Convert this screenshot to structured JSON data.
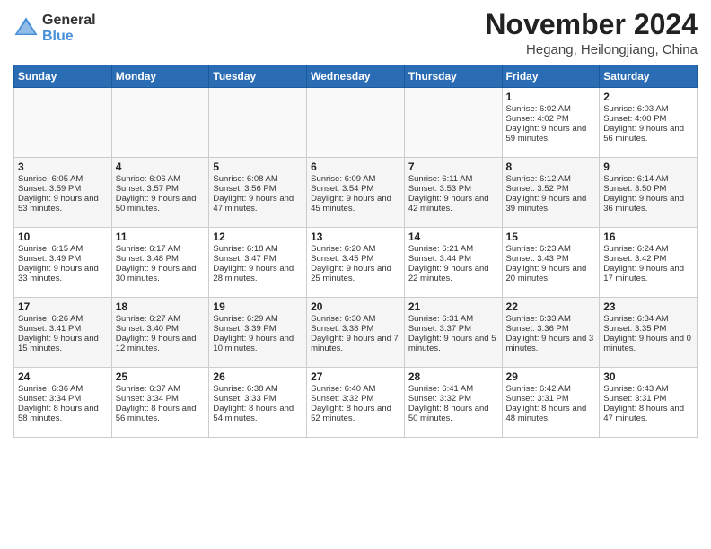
{
  "header": {
    "logo_general": "General",
    "logo_blue": "Blue",
    "month_title": "November 2024",
    "location": "Hegang, Heilongjiang, China"
  },
  "weekdays": [
    "Sunday",
    "Monday",
    "Tuesday",
    "Wednesday",
    "Thursday",
    "Friday",
    "Saturday"
  ],
  "weeks": [
    [
      {
        "day": "",
        "info": ""
      },
      {
        "day": "",
        "info": ""
      },
      {
        "day": "",
        "info": ""
      },
      {
        "day": "",
        "info": ""
      },
      {
        "day": "",
        "info": ""
      },
      {
        "day": "1",
        "info": "Sunrise: 6:02 AM\nSunset: 4:02 PM\nDaylight: 9 hours and 59 minutes."
      },
      {
        "day": "2",
        "info": "Sunrise: 6:03 AM\nSunset: 4:00 PM\nDaylight: 9 hours and 56 minutes."
      }
    ],
    [
      {
        "day": "3",
        "info": "Sunrise: 6:05 AM\nSunset: 3:59 PM\nDaylight: 9 hours and 53 minutes."
      },
      {
        "day": "4",
        "info": "Sunrise: 6:06 AM\nSunset: 3:57 PM\nDaylight: 9 hours and 50 minutes."
      },
      {
        "day": "5",
        "info": "Sunrise: 6:08 AM\nSunset: 3:56 PM\nDaylight: 9 hours and 47 minutes."
      },
      {
        "day": "6",
        "info": "Sunrise: 6:09 AM\nSunset: 3:54 PM\nDaylight: 9 hours and 45 minutes."
      },
      {
        "day": "7",
        "info": "Sunrise: 6:11 AM\nSunset: 3:53 PM\nDaylight: 9 hours and 42 minutes."
      },
      {
        "day": "8",
        "info": "Sunrise: 6:12 AM\nSunset: 3:52 PM\nDaylight: 9 hours and 39 minutes."
      },
      {
        "day": "9",
        "info": "Sunrise: 6:14 AM\nSunset: 3:50 PM\nDaylight: 9 hours and 36 minutes."
      }
    ],
    [
      {
        "day": "10",
        "info": "Sunrise: 6:15 AM\nSunset: 3:49 PM\nDaylight: 9 hours and 33 minutes."
      },
      {
        "day": "11",
        "info": "Sunrise: 6:17 AM\nSunset: 3:48 PM\nDaylight: 9 hours and 30 minutes."
      },
      {
        "day": "12",
        "info": "Sunrise: 6:18 AM\nSunset: 3:47 PM\nDaylight: 9 hours and 28 minutes."
      },
      {
        "day": "13",
        "info": "Sunrise: 6:20 AM\nSunset: 3:45 PM\nDaylight: 9 hours and 25 minutes."
      },
      {
        "day": "14",
        "info": "Sunrise: 6:21 AM\nSunset: 3:44 PM\nDaylight: 9 hours and 22 minutes."
      },
      {
        "day": "15",
        "info": "Sunrise: 6:23 AM\nSunset: 3:43 PM\nDaylight: 9 hours and 20 minutes."
      },
      {
        "day": "16",
        "info": "Sunrise: 6:24 AM\nSunset: 3:42 PM\nDaylight: 9 hours and 17 minutes."
      }
    ],
    [
      {
        "day": "17",
        "info": "Sunrise: 6:26 AM\nSunset: 3:41 PM\nDaylight: 9 hours and 15 minutes."
      },
      {
        "day": "18",
        "info": "Sunrise: 6:27 AM\nSunset: 3:40 PM\nDaylight: 9 hours and 12 minutes."
      },
      {
        "day": "19",
        "info": "Sunrise: 6:29 AM\nSunset: 3:39 PM\nDaylight: 9 hours and 10 minutes."
      },
      {
        "day": "20",
        "info": "Sunrise: 6:30 AM\nSunset: 3:38 PM\nDaylight: 9 hours and 7 minutes."
      },
      {
        "day": "21",
        "info": "Sunrise: 6:31 AM\nSunset: 3:37 PM\nDaylight: 9 hours and 5 minutes."
      },
      {
        "day": "22",
        "info": "Sunrise: 6:33 AM\nSunset: 3:36 PM\nDaylight: 9 hours and 3 minutes."
      },
      {
        "day": "23",
        "info": "Sunrise: 6:34 AM\nSunset: 3:35 PM\nDaylight: 9 hours and 0 minutes."
      }
    ],
    [
      {
        "day": "24",
        "info": "Sunrise: 6:36 AM\nSunset: 3:34 PM\nDaylight: 8 hours and 58 minutes."
      },
      {
        "day": "25",
        "info": "Sunrise: 6:37 AM\nSunset: 3:34 PM\nDaylight: 8 hours and 56 minutes."
      },
      {
        "day": "26",
        "info": "Sunrise: 6:38 AM\nSunset: 3:33 PM\nDaylight: 8 hours and 54 minutes."
      },
      {
        "day": "27",
        "info": "Sunrise: 6:40 AM\nSunset: 3:32 PM\nDaylight: 8 hours and 52 minutes."
      },
      {
        "day": "28",
        "info": "Sunrise: 6:41 AM\nSunset: 3:32 PM\nDaylight: 8 hours and 50 minutes."
      },
      {
        "day": "29",
        "info": "Sunrise: 6:42 AM\nSunset: 3:31 PM\nDaylight: 8 hours and 48 minutes."
      },
      {
        "day": "30",
        "info": "Sunrise: 6:43 AM\nSunset: 3:31 PM\nDaylight: 8 hours and 47 minutes."
      }
    ]
  ]
}
